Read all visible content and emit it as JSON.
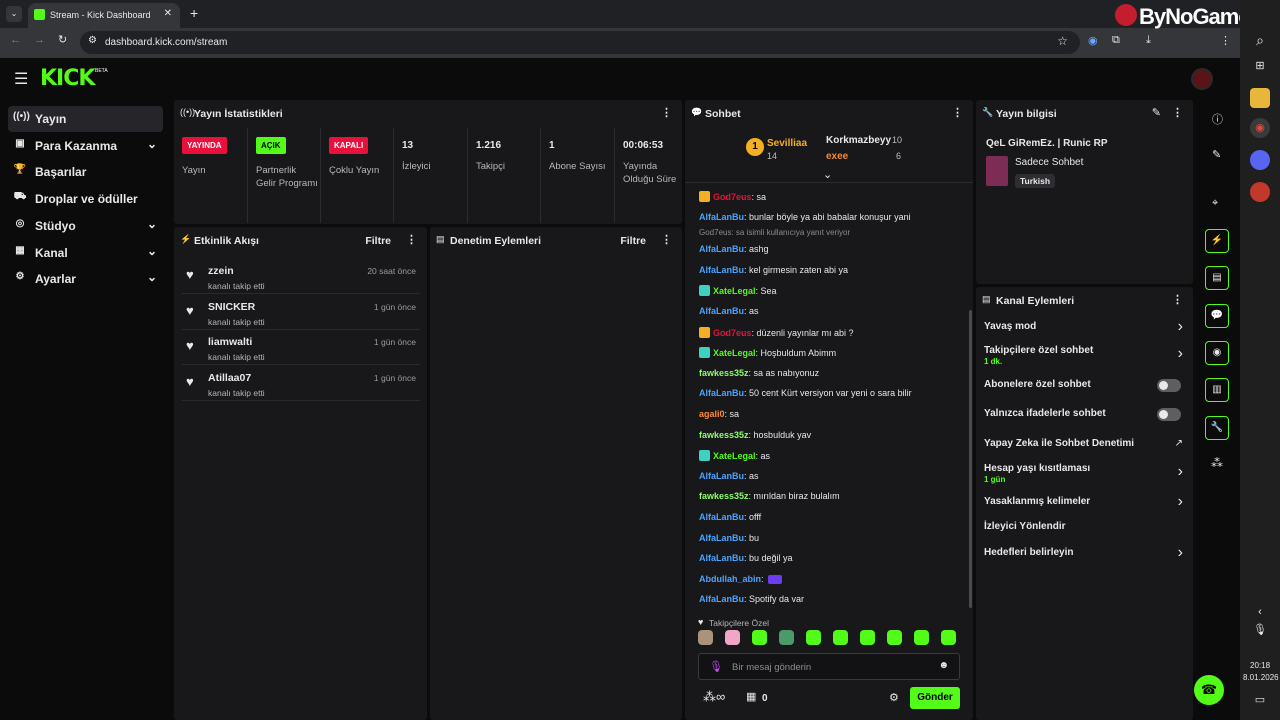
{
  "browser": {
    "tab_title": "Stream - Kick Dashboard",
    "url": "dashboard.kick.com/stream"
  },
  "watermark": "ByNoGame",
  "brand": {
    "logo": "KICK",
    "beta": "BETA",
    "accent": "#53fc18"
  },
  "sidebar": {
    "items": [
      {
        "label": "Yayın",
        "icon": "broadcast-icon"
      },
      {
        "label": "Para Kazanma",
        "icon": "money-icon"
      },
      {
        "label": "Başarılar",
        "icon": "trophy-icon"
      },
      {
        "label": "Droplar ve ödüller",
        "icon": "gift-icon"
      },
      {
        "label": "Stüdyo",
        "icon": "studio-icon"
      },
      {
        "label": "Kanal",
        "icon": "channel-icon"
      },
      {
        "label": "Ayarlar",
        "icon": "gear-icon"
      }
    ]
  },
  "stats": {
    "title": "Yayın İstatistikleri",
    "items": [
      {
        "badge": "YAYINDA",
        "label": "Yayın"
      },
      {
        "badge": "AÇIK",
        "label": "Partnerlik Gelir Programı"
      },
      {
        "badge": "KAPALI",
        "label": "Çoklu Yayın"
      },
      {
        "value": "13",
        "label": "İzleyici"
      },
      {
        "value": "1.216",
        "label": "Takipçi"
      },
      {
        "value": "1",
        "label": "Abone Sayısı"
      },
      {
        "value": "00:06:53",
        "label": "Yayında Olduğu Süre"
      }
    ]
  },
  "activity": {
    "title": "Etkinlik Akışı",
    "filter": "Filtre",
    "events": [
      {
        "name": "zzein",
        "action": "kanalı takip etti",
        "time": "20 saat önce"
      },
      {
        "name": "SNICKER",
        "action": "kanalı takip etti",
        "time": "1 gün önce"
      },
      {
        "name": "liamwalti",
        "action": "kanalı takip etti",
        "time": "1 gün önce"
      },
      {
        "name": "Atillaa07",
        "action": "kanalı takip etti",
        "time": "1 gün önce"
      }
    ]
  },
  "moderation": {
    "title": "Denetim Eylemleri",
    "filter": "Filtre"
  },
  "chat": {
    "title": "Sohbet",
    "leaderboard": {
      "first": {
        "name": "Sevilliaa",
        "score": "14"
      },
      "second": {
        "name": "Korkmazbeyy",
        "score": "10"
      },
      "third": {
        "name": "exee",
        "score": "6"
      }
    },
    "messages": [
      {
        "user": "God7eus",
        "text": ": sa",
        "color": "#e9113c",
        "badge": "crown"
      },
      {
        "user": "AlfaLanBu",
        "text": ": bunlar böyle ya abi babalar konuşur yani",
        "color": "#4aa3ff"
      },
      {
        "user": "AlfaLanBu",
        "text": ": ashg",
        "color": "#4aa3ff",
        "reply": "God7eus: sa isimli kullanıcıya yanıt veriyor"
      },
      {
        "user": "AlfaLanBu",
        "text": ": kel girmesin zaten abi ya",
        "color": "#4aa3ff"
      },
      {
        "user": "XateLegal",
        "text": ": Sea",
        "color": "#53fc18",
        "badge": "gift"
      },
      {
        "user": "AlfaLanBu",
        "text": ": as",
        "color": "#4aa3ff"
      },
      {
        "user": "God7eus",
        "text": ": düzenli yayınlar mı abi ?",
        "color": "#e9113c",
        "badge": "crown"
      },
      {
        "user": "XateLegal",
        "text": ": Hoşbuldum Abimm",
        "color": "#53fc18",
        "badge": "gift"
      },
      {
        "user": "fawkess35z",
        "text": ": sa as nabıyonuz",
        "color": "#8cff6b"
      },
      {
        "user": "AlfaLanBu",
        "text": ": 50 cent Kürt versiyon var yeni o sara bilir",
        "color": "#4aa3ff"
      },
      {
        "user": "agali0",
        "text": ": sa",
        "color": "#ff8a3d"
      },
      {
        "user": "fawkess35z",
        "text": ": hosbulduk yav",
        "color": "#8cff6b"
      },
      {
        "user": "XateLegal",
        "text": ": as",
        "color": "#53fc18",
        "badge": "gift"
      },
      {
        "user": "AlfaLanBu",
        "text": ": as",
        "color": "#4aa3ff"
      },
      {
        "user": "fawkess35z",
        "text": ": mırıldan biraz bulalım",
        "color": "#8cff6b"
      },
      {
        "user": "AlfaLanBu",
        "text": ": offf",
        "color": "#4aa3ff"
      },
      {
        "user": "AlfaLanBu",
        "text": ": bu",
        "color": "#4aa3ff"
      },
      {
        "user": "AlfaLanBu",
        "text": ": bu değil ya",
        "color": "#4aa3ff"
      },
      {
        "user": "Abdullah_abin",
        "text": ": ",
        "color": "#4aa3ff",
        "emote": true
      },
      {
        "user": "AlfaLanBu",
        "text": ": Spotify da var",
        "color": "#4aa3ff"
      }
    ],
    "followers_only": "Takipçilere Özel",
    "placeholder": "Bir mesaj gönderin",
    "count": "0",
    "send": "Gönder"
  },
  "info": {
    "title": "Yayın bilgisi",
    "stream_title": "QeL GiRemEz. | Runic RP",
    "category": "Sadece Sohbet",
    "language": "Turkish"
  },
  "actions": {
    "title": "Kanal Eylemleri",
    "items": [
      {
        "label": "Yavaş mod",
        "control": "chevron"
      },
      {
        "label": "Takipçilere özel sohbet",
        "sub": "1 dk.",
        "control": "chevron"
      },
      {
        "label": "Abonelere özel sohbet",
        "control": "toggle"
      },
      {
        "label": "Yalnızca ifadelerle sohbet",
        "control": "toggle"
      },
      {
        "label": "Yapay Zeka ile Sohbet Denetimi",
        "control": "external"
      },
      {
        "label": "Hesap yaşı kısıtlaması",
        "sub": "1 gün",
        "control": "chevron"
      },
      {
        "label": "Yasaklanmış kelimeler",
        "control": "chevron"
      },
      {
        "label": "İzleyici Yönlendir",
        "control": "none"
      },
      {
        "label": "Hedefleri belirleyin",
        "control": "chevron"
      }
    ]
  },
  "taskbar": {
    "time": "20:18",
    "date": "8.01.2026"
  }
}
